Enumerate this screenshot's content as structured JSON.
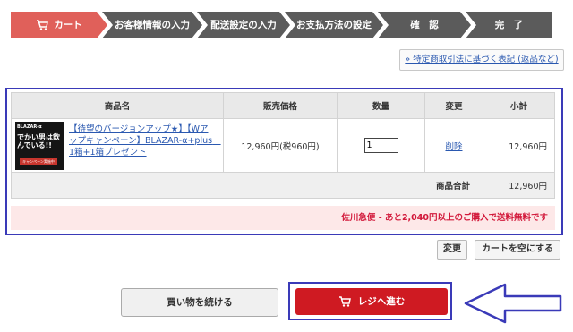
{
  "steps": [
    {
      "label": "カート",
      "active": true
    },
    {
      "label": "お客様情報の入力",
      "active": false
    },
    {
      "label": "配送設定の入力",
      "active": false
    },
    {
      "label": "お支払方法の設定",
      "active": false
    },
    {
      "label": "確　認",
      "active": false
    },
    {
      "label": "完　了",
      "active": false
    }
  ],
  "notice": {
    "link_text": "» 特定商取引法に基づく表記 (返品など)"
  },
  "cart": {
    "headers": {
      "name": "商品名",
      "price": "販売価格",
      "quantity": "数量",
      "change": "変更",
      "subtotal": "小計"
    },
    "item": {
      "thumb_brand": "BLAZAR-α",
      "thumb_text": "でかい男は飲んでいる!!",
      "thumb_banner": "キャンペーン実施中",
      "name": "【待望のバージョンアップ★】【Wアップキャンペーン】BLAZAR-α+plus　1箱+1箱プレゼント",
      "price": "12,960円(税960円)",
      "quantity": "1",
      "delete_label": "削除",
      "subtotal": "12,960円"
    },
    "total_label": "商品合計",
    "total_value": "12,960円",
    "shipping_message": "佐川急便 - あと2,040円以上のご購入で送料無料です"
  },
  "actions": {
    "update_label": "変更",
    "empty_cart_label": "カートを空にする",
    "continue_label": "買い物を続ける",
    "checkout_label": "レジへ進む"
  },
  "colors": {
    "active_step": "#e0605a",
    "inactive_step": "#5b5b5b",
    "checkout_button": "#cf1a22",
    "highlight_border": "#3a3ab8",
    "link": "#2a58b0",
    "shipping_text": "#d2183a"
  },
  "icons": {
    "cart": "cart-icon",
    "arrow": "left-arrow-icon"
  }
}
